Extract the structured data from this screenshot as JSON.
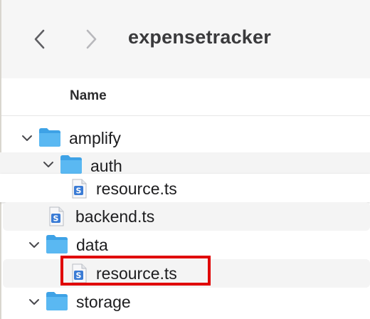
{
  "window": {
    "title": "expensetracker"
  },
  "toolbar": {
    "back_icon": "chevron-left-icon",
    "forward_icon": "chevron-right-icon"
  },
  "columns": {
    "name": "Name"
  },
  "tree": [
    {
      "id": "amplify",
      "label": "amplify",
      "type": "folder",
      "expanded": true,
      "depth": 0
    },
    {
      "id": "auth",
      "label": "auth",
      "type": "folder",
      "expanded": true,
      "depth": 1
    },
    {
      "id": "auth-resource",
      "label": "resource.ts",
      "type": "file",
      "icon": "typescript-file-icon",
      "depth": 2
    },
    {
      "id": "backend",
      "label": "backend.ts",
      "type": "file",
      "icon": "typescript-file-icon",
      "depth": 1
    },
    {
      "id": "data",
      "label": "data",
      "type": "folder",
      "expanded": true,
      "depth": 1
    },
    {
      "id": "data-resource",
      "label": "resource.ts",
      "type": "file",
      "icon": "typescript-file-icon",
      "depth": 2,
      "highlighted": true
    },
    {
      "id": "storage",
      "label": "storage",
      "type": "folder",
      "expanded": true,
      "depth": 1
    }
  ],
  "colors": {
    "folder": "#5ab8f2",
    "folder_dark": "#3ea2e6",
    "highlight": "#e00000",
    "file_badge": "#3a7bd5"
  }
}
